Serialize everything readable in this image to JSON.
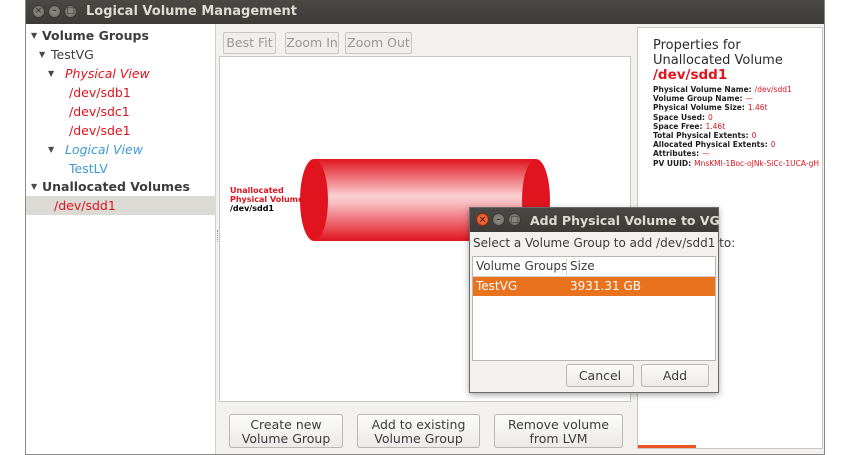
{
  "window": {
    "title": "Logical Volume Management"
  },
  "tree": {
    "volume_groups": "Volume Groups",
    "vg_name": "TestVG",
    "physical_view": "Physical View",
    "pvs": [
      "/dev/sdb1",
      "/dev/sdc1",
      "/dev/sde1"
    ],
    "logical_view": "Logical View",
    "lvs": [
      "TestLV"
    ],
    "unallocated_volumes": "Unallocated Volumes",
    "unallocated": [
      "/dev/sdd1"
    ]
  },
  "toolbar": {
    "best_fit": "Best Fit",
    "zoom_in": "Zoom In",
    "zoom_out": "Zoom Out"
  },
  "canvas": {
    "label_line1": "Unallocated",
    "label_line2": "Physical Volume",
    "label_line3": "/dev/sdd1",
    "cylinder_color": "#e0141e"
  },
  "buttons": {
    "create_line1": "Create new",
    "create_line2": "Volume Group",
    "add_line1": "Add to existing",
    "add_line2": "Volume Group",
    "remove_line1": "Remove volume",
    "remove_line2": "from LVM"
  },
  "properties": {
    "heading1": "Properties for",
    "heading2": "Unallocated Volume",
    "device": "/dev/sdd1",
    "items": [
      {
        "key": "Physical Volume Name:",
        "value": "/dev/sdd1"
      },
      {
        "key": "Volume Group Name:",
        "value": "—"
      },
      {
        "key": "Physical Volume Size:",
        "value": "1.46t"
      },
      {
        "key": "Space Used:",
        "value": "0"
      },
      {
        "key": "Space Free:",
        "value": "1.46t"
      },
      {
        "key": "Total Physical Extents:",
        "value": "0"
      },
      {
        "key": "Allocated Physical Extents:",
        "value": "0"
      },
      {
        "key": "Attributes:",
        "value": "—"
      },
      {
        "key": "PV UUID:",
        "value": "MnsKMI-1Boc-oJNk-SiCc-1UCA-gH"
      }
    ]
  },
  "dialog": {
    "title": "Add Physical Volume to VG",
    "prompt": "Select a Volume Group to add /dev/sdd1 to:",
    "columns": [
      "Volume Groups",
      "Size"
    ],
    "rows": [
      {
        "group": "TestVG",
        "size": "3931.31 GB"
      }
    ],
    "cancel": "Cancel",
    "add": "Add",
    "accent": "#e9721f"
  }
}
